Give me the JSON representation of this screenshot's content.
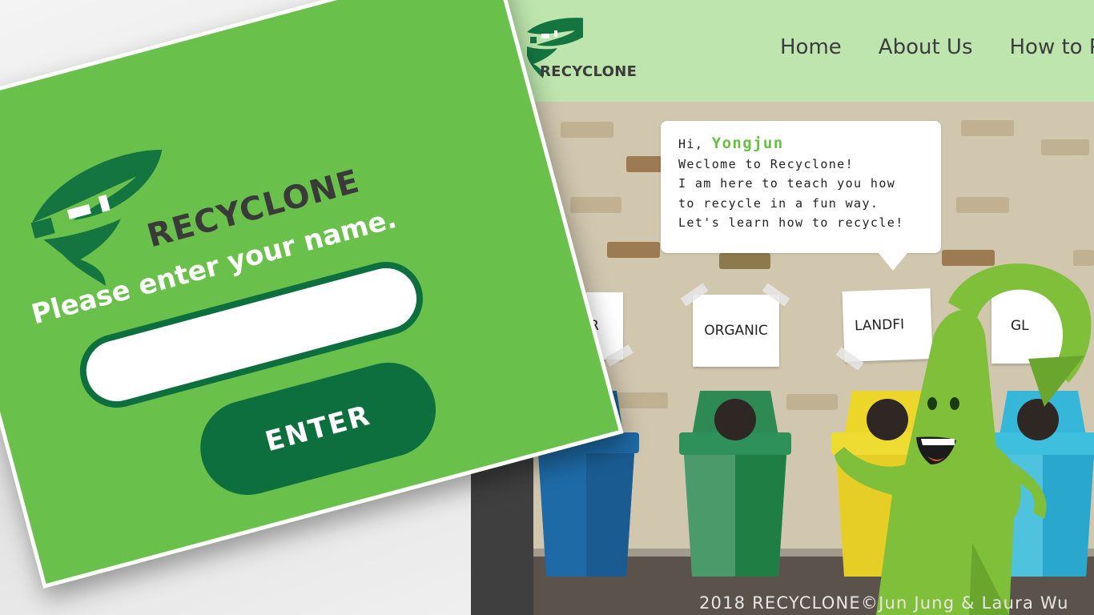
{
  "site": {
    "logo_text": "RECYCLONE",
    "nav": [
      {
        "label": "Home"
      },
      {
        "label": "About Us"
      },
      {
        "label": "How to P"
      }
    ],
    "bubble": {
      "greeting": "Hi, ",
      "name": "Yongjun",
      "line1": "Weclome to Recyclone!",
      "line2": "I am here to teach you how",
      "line3": "to recycle in a fun way.",
      "line4": "Let's learn how to recycle!"
    },
    "bins": [
      {
        "label": "PER",
        "color": "#1e6aa6"
      },
      {
        "label": "ORGANIC",
        "color": "#2d8a53"
      },
      {
        "label": "LANDFI",
        "color": "#ecd629"
      },
      {
        "label": "GL",
        "color": "#36b6d8"
      }
    ],
    "mascot_color": "#7fbf3a",
    "footer": "2018 RECYCLONE©Jun Jung & Laura Wu"
  },
  "modal": {
    "logo_text": "RECYCLONE",
    "prompt": "Please enter your name.",
    "input_value": "",
    "button_label": "ENTER",
    "bg_color": "#69c04a",
    "accent_color": "#0e6f3e"
  }
}
